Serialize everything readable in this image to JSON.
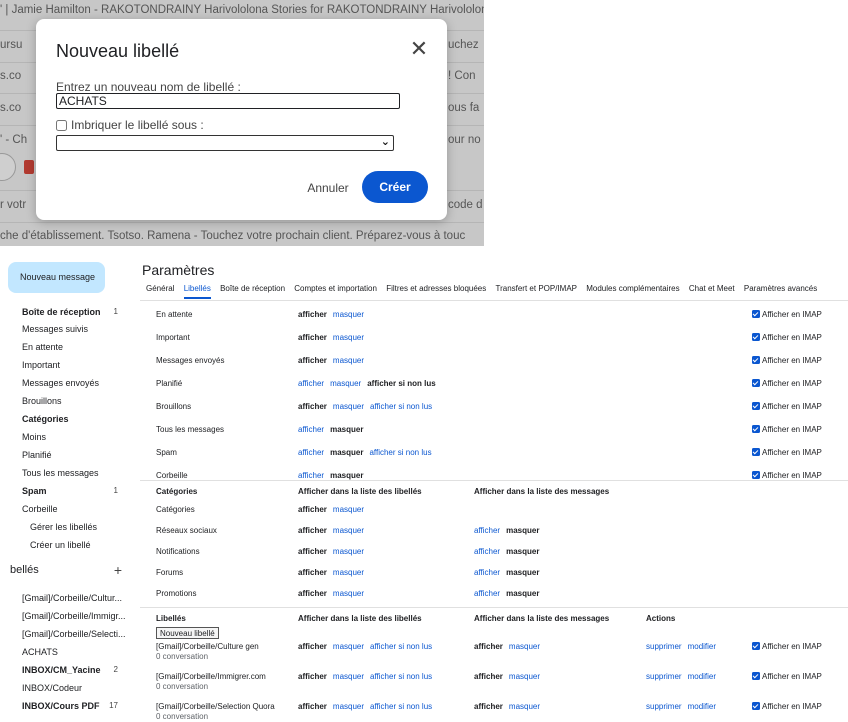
{
  "background": {
    "lines": [
      {
        "text": "' | Jamie Hamilton - RAKOTONDRAINY Harivololona Stories for RAKOTONDRAINY Harivololon"
      },
      {
        "text": "ursu"
      },
      {
        "text": "s.co"
      },
      {
        "text": "s.co"
      },
      {
        "text": "' - Ch"
      },
      {
        "text": "r votr"
      },
      {
        "text": "che d'établissement. Tsotso. Ramena - Touchez votre prochain client. Préparez-vous à touc"
      }
    ],
    "right_fragments": [
      "uchez",
      "! Con",
      "ous fa",
      "our no",
      "code d"
    ]
  },
  "modal": {
    "title": "Nouveau libellé",
    "name_label": "Entrez un nouveau nom de libellé :",
    "name_value": "ACHATS",
    "nest_label": "Imbriquer le libellé sous :",
    "cancel": "Annuler",
    "create": "Créer",
    "accent": "#0b57d0"
  },
  "sidebar": {
    "compose": "Nouveau message",
    "items": [
      {
        "label": "Boîte de réception",
        "count": "1"
      },
      {
        "label": "Messages suivis"
      },
      {
        "label": "En attente"
      },
      {
        "label": "Important"
      },
      {
        "label": "Messages envoyés"
      },
      {
        "label": "Brouillons"
      },
      {
        "label": "Catégories"
      },
      {
        "label": "Moins"
      },
      {
        "label": "Planifié"
      },
      {
        "label": "Tous les messages"
      },
      {
        "label": "Spam",
        "count": "1"
      },
      {
        "label": "Corbeille"
      },
      {
        "label": "Gérer les libellés"
      },
      {
        "label": "Créer un libellé"
      }
    ],
    "labels_header": "bellés",
    "labels": [
      {
        "label": "[Gmail]/Corbeille/Cultur..."
      },
      {
        "label": "[Gmail]/Corbeille/Immigr..."
      },
      {
        "label": "[Gmail]/Corbeille/Selecti..."
      },
      {
        "label": "ACHATS"
      },
      {
        "label": "INBOX/CM_Yacine",
        "count": "2"
      },
      {
        "label": "INBOX/Codeur"
      },
      {
        "label": "INBOX/Cours PDF",
        "count": "17"
      }
    ]
  },
  "settings": {
    "title": "Paramètres",
    "tabs": [
      "Général",
      "Libellés",
      "Boîte de réception",
      "Comptes et importation",
      "Filtres et adresses bloquées",
      "Transfert et POP/IMAP",
      "Modules complémentaires",
      "Chat et Meet",
      "Paramètres avancés"
    ],
    "imap_label": "Afficher en IMAP",
    "show": "afficher",
    "hide": "masquer",
    "show_unread": "afficher si non lus",
    "system_labels": [
      {
        "name": "En attente"
      },
      {
        "name": "Important"
      },
      {
        "name": "Messages envoyés"
      },
      {
        "name": "Planifié"
      },
      {
        "name": "Brouillons"
      },
      {
        "name": "Tous les messages"
      },
      {
        "name": "Spam"
      },
      {
        "name": "Corbeille"
      }
    ],
    "categories_header": {
      "col1": "Catégories",
      "col2": "Afficher dans la liste des libellés",
      "col3": "Afficher dans la liste des messages"
    },
    "categories": [
      {
        "name": "Catégories"
      },
      {
        "name": "Réseaux sociaux"
      },
      {
        "name": "Notifications"
      },
      {
        "name": "Forums"
      },
      {
        "name": "Promotions"
      }
    ],
    "labels_header": {
      "col1": "Libellés",
      "col2": "Afficher dans la liste des libellés",
      "col3": "Afficher dans la liste des messages",
      "col4": "Actions"
    },
    "new_label_button": "Nouveau libellé",
    "delete": "supprimer",
    "edit": "modifier",
    "user_labels": [
      {
        "name": "[Gmail]/Corbeille/Culture gen",
        "sub": "0 conversation"
      },
      {
        "name": "[Gmail]/Corbeille/Immigrer.com",
        "sub": "0 conversation"
      },
      {
        "name": "[Gmail]/Corbeille/Selection Quora",
        "sub": "0 conversation"
      }
    ]
  }
}
